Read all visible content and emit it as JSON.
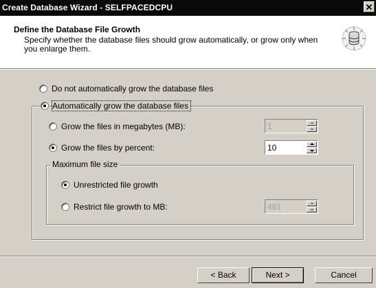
{
  "window": {
    "title": "Create Database Wizard - SELFPACEDCPU",
    "close_glyph": "✕"
  },
  "header": {
    "title": "Define the Database File Growth",
    "description": "Specify whether the database files should grow automatically, or grow only when you enlarge them."
  },
  "options": {
    "no_autogrow": "Do not automatically grow the database files",
    "autogrow": "Automatically grow the database files",
    "grow_mb": "Grow the files in megabytes (MB):",
    "grow_mb_value": "1",
    "grow_percent": "Grow the files by percent:",
    "grow_percent_value": "10",
    "max_size_caption": "Maximum file size",
    "unrestricted": "Unrestricted file growth",
    "restrict": "Restrict file growth to MB:",
    "restrict_value": "481"
  },
  "buttons": {
    "back": "< Back",
    "next": "Next >",
    "cancel": "Cancel"
  }
}
